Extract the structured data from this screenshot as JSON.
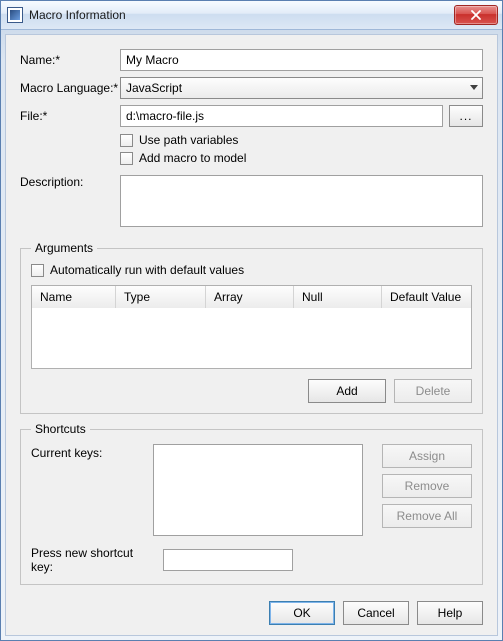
{
  "window": {
    "title": "Macro Information"
  },
  "labels": {
    "name": "Name:*",
    "macro_language": "Macro Language:*",
    "file": "File:*",
    "description": "Description:",
    "arguments_legend": "Arguments",
    "shortcuts_legend": "Shortcuts",
    "current_keys": "Current keys:",
    "press_new_shortcut": "Press new shortcut key:"
  },
  "fields": {
    "name_value": "My Macro",
    "language_value": "JavaScript",
    "file_value": "d:\\macro-file.js",
    "description_value": "",
    "shortcut_input_value": ""
  },
  "checkboxes": {
    "use_path_variables": "Use path variables",
    "add_macro_to_model": "Add macro to model",
    "auto_run_defaults": "Automatically run with default values"
  },
  "args_table": {
    "columns": {
      "name": "Name",
      "type": "Type",
      "array": "Array",
      "null": "Null",
      "default": "Default Value"
    }
  },
  "buttons": {
    "browse": "...",
    "add": "Add",
    "delete": "Delete",
    "assign": "Assign",
    "remove": "Remove",
    "remove_all": "Remove All",
    "ok": "OK",
    "cancel": "Cancel",
    "help": "Help"
  }
}
